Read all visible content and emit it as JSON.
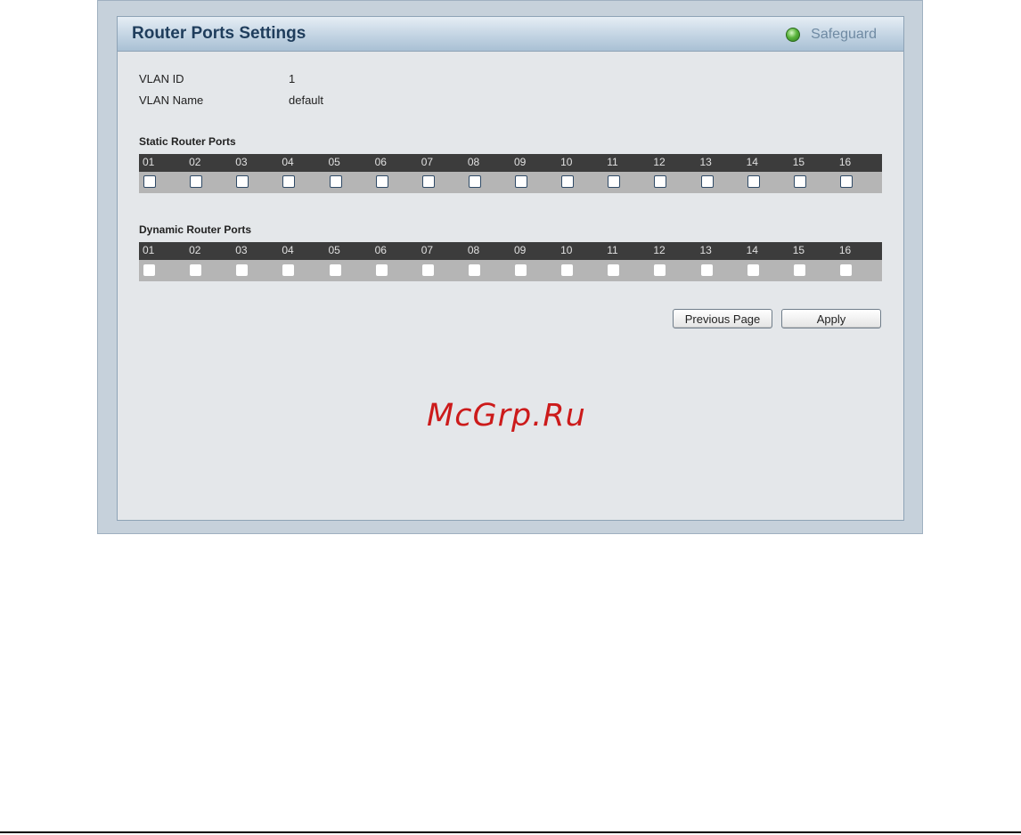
{
  "panel": {
    "title": "Router Ports Settings",
    "safeguard_label": "Safeguard"
  },
  "vlan": {
    "id_label": "VLAN ID",
    "id_value": "1",
    "name_label": "VLAN Name",
    "name_value": "default"
  },
  "static_ports": {
    "title": "Static Router Ports",
    "ports": [
      "01",
      "02",
      "03",
      "04",
      "05",
      "06",
      "07",
      "08",
      "09",
      "10",
      "11",
      "12",
      "13",
      "14",
      "15",
      "16"
    ]
  },
  "dynamic_ports": {
    "title": "Dynamic Router Ports",
    "ports": [
      "01",
      "02",
      "03",
      "04",
      "05",
      "06",
      "07",
      "08",
      "09",
      "10",
      "11",
      "12",
      "13",
      "14",
      "15",
      "16"
    ]
  },
  "buttons": {
    "previous_page": "Previous Page",
    "apply": "Apply"
  },
  "watermark": "McGrp.Ru",
  "colors": {
    "accent": "#1f3d5c",
    "safeguard_green": "#5ab43c",
    "header_dark": "#3c3c3c",
    "watermark": "#cc1b1b"
  }
}
